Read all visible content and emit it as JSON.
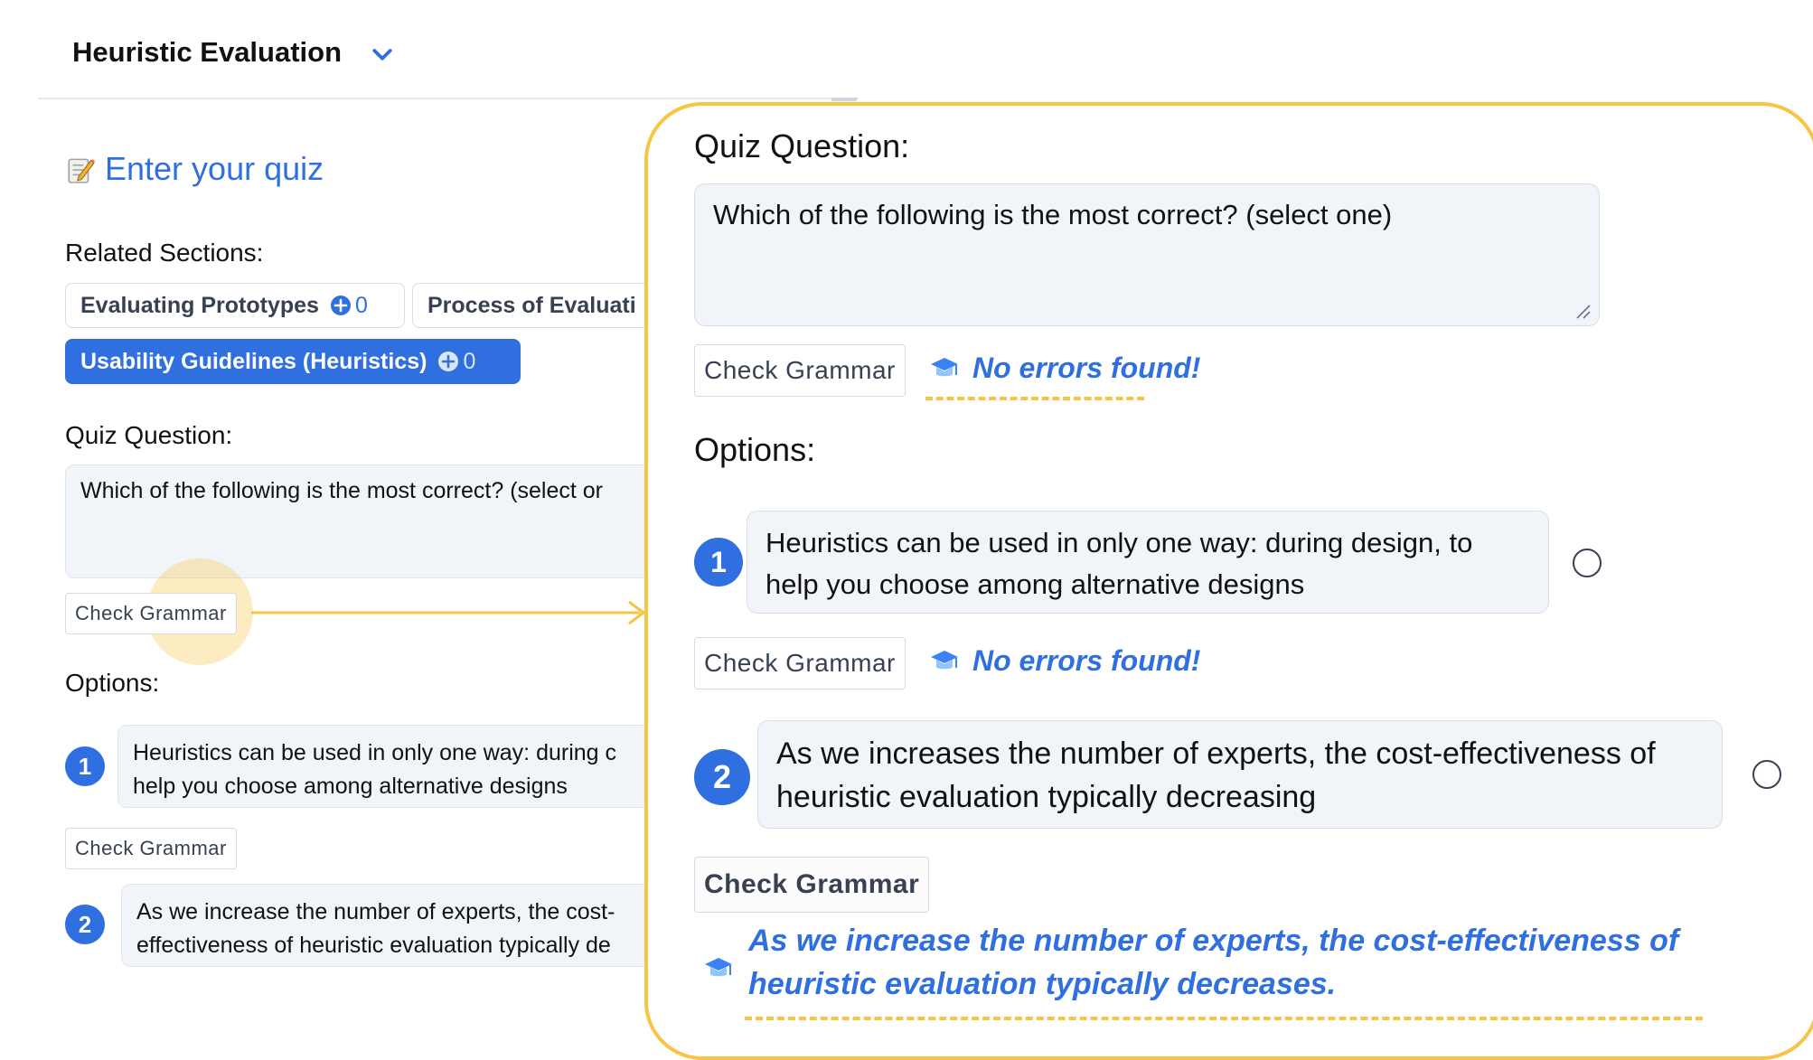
{
  "header": {
    "title": "Heuristic Evaluation"
  },
  "quiz_form": {
    "heading": "Enter your quiz",
    "related_label": "Related Sections:",
    "sections": [
      {
        "label": "Evaluating Prototypes",
        "count": "0",
        "active": false
      },
      {
        "label": "Process of Evaluati",
        "count": "",
        "active": false
      },
      {
        "label": "Usability Guidelines (Heuristics)",
        "count": "0",
        "active": true
      }
    ],
    "question_label": "Quiz Question:",
    "question_text": "Which of the following is the most correct? (select or",
    "check_grammar_label": "Check Grammar",
    "options_label": "Options:",
    "options": [
      {
        "number": "1",
        "line1": "Heuristics can be used in only one way: during c",
        "line2": "help you choose among alternative designs"
      },
      {
        "number": "2",
        "line1": "As we increase the number of experts, the cost-",
        "line2": "effectiveness of heuristic evaluation typically de"
      }
    ]
  },
  "zoom": {
    "question_label": "Quiz Question:",
    "question_text": "Which of the following is the most correct? (select one)",
    "check_grammar_label": "Check Grammar",
    "no_errors": "No errors found!",
    "options_label": "Options:",
    "options": [
      {
        "number": "1",
        "line1": "Heuristics can be used in only one way: during design, to",
        "line2": "help you choose among alternative designs"
      },
      {
        "number": "2",
        "line1": "As we increases the number of experts, the cost-effectiveness of",
        "line2": "heuristic evaluation typically decreasing"
      }
    ],
    "suggestion": {
      "line1": "As we increase the number of experts, the cost-effectiveness of",
      "line2": "heuristic evaluation typically decreases."
    }
  },
  "colors": {
    "accent": "#2f6fe0",
    "highlight": "#f7c543"
  },
  "icons": [
    "chevron-down-icon",
    "memo-icon",
    "plus-circle-icon",
    "graduation-cap-icon",
    "arrow-right-icon"
  ]
}
